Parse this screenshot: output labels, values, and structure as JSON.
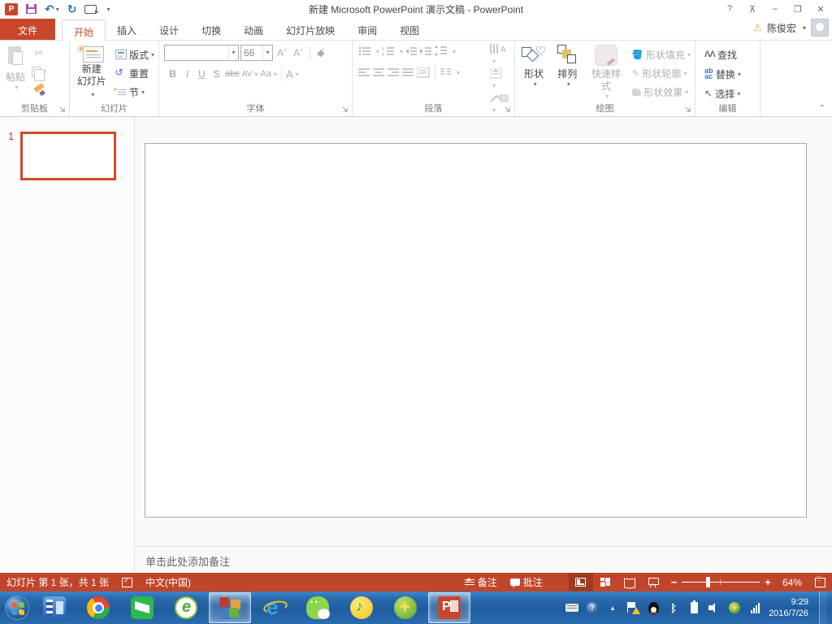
{
  "title_bar": {
    "title": "新建 Microsoft PowerPoint 演示文稿 - PowerPoint",
    "help": "?",
    "minimize": "–",
    "restore": "❐",
    "close": "✕",
    "ribbon_options": "⊼"
  },
  "tabs": {
    "file": "文件",
    "items": [
      {
        "label": "开始"
      },
      {
        "label": "插入"
      },
      {
        "label": "设计"
      },
      {
        "label": "切换"
      },
      {
        "label": "动画"
      },
      {
        "label": "幻灯片放映"
      },
      {
        "label": "审阅"
      },
      {
        "label": "视图"
      }
    ]
  },
  "account": {
    "name": "陈俊宏"
  },
  "ribbon": {
    "clipboard": {
      "label": "剪贴板",
      "paste": "粘贴"
    },
    "slides": {
      "label": "幻灯片",
      "new1": "新建",
      "new2": "幻灯片",
      "layout": "版式",
      "reset": "重置",
      "section": "节"
    },
    "font": {
      "label": "字体",
      "size": "66",
      "bold": "B",
      "italic": "I",
      "underline": "U",
      "shadow": "S",
      "strike": "abc",
      "spacing": "AV",
      "case": "Aa",
      "color": "A"
    },
    "paragraph": {
      "label": "段落"
    },
    "drawing": {
      "label": "绘图",
      "shapes": "形状",
      "arrange": "排列",
      "quick_styles": "快速样式",
      "fill": "形状填充",
      "outline": "形状轮廓",
      "effects": "形状效果"
    },
    "editing": {
      "label": "编辑",
      "find": "查找",
      "replace": "替换",
      "select": "选择"
    }
  },
  "slide_panel": {
    "number": "1"
  },
  "notes": {
    "placeholder": "单击此处添加备注"
  },
  "status_bar": {
    "slide_info": "幻灯片 第 1 张，共 1 张",
    "language": "中文(中国)",
    "notes": "备注",
    "comments": "批注",
    "zoom": "64%"
  },
  "taskbar": {
    "time": "9:29",
    "date": "2016/7/26"
  }
}
